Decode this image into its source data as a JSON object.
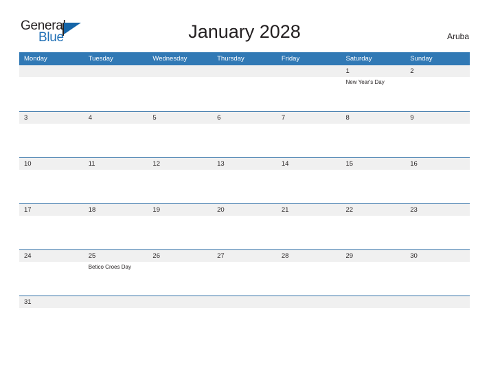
{
  "brand": {
    "word_one": "General",
    "word_two": "Blue",
    "flag_icon": "flag-triangle-icon",
    "blue": "#1565a8"
  },
  "header": {
    "title": "January 2028",
    "region": "Aruba"
  },
  "calendar": {
    "header_bg": "#3179b5",
    "band_bg": "#f0f0f0",
    "rule_color": "#2e6da4",
    "weekdays": [
      "Monday",
      "Tuesday",
      "Wednesday",
      "Thursday",
      "Friday",
      "Saturday",
      "Sunday"
    ],
    "weeks": [
      [
        {
          "day": "",
          "event": ""
        },
        {
          "day": "",
          "event": ""
        },
        {
          "day": "",
          "event": ""
        },
        {
          "day": "",
          "event": ""
        },
        {
          "day": "",
          "event": ""
        },
        {
          "day": "1",
          "event": "New Year's Day"
        },
        {
          "day": "2",
          "event": ""
        }
      ],
      [
        {
          "day": "3",
          "event": ""
        },
        {
          "day": "4",
          "event": ""
        },
        {
          "day": "5",
          "event": ""
        },
        {
          "day": "6",
          "event": ""
        },
        {
          "day": "7",
          "event": ""
        },
        {
          "day": "8",
          "event": ""
        },
        {
          "day": "9",
          "event": ""
        }
      ],
      [
        {
          "day": "10",
          "event": ""
        },
        {
          "day": "11",
          "event": ""
        },
        {
          "day": "12",
          "event": ""
        },
        {
          "day": "13",
          "event": ""
        },
        {
          "day": "14",
          "event": ""
        },
        {
          "day": "15",
          "event": ""
        },
        {
          "day": "16",
          "event": ""
        }
      ],
      [
        {
          "day": "17",
          "event": ""
        },
        {
          "day": "18",
          "event": ""
        },
        {
          "day": "19",
          "event": ""
        },
        {
          "day": "20",
          "event": ""
        },
        {
          "day": "21",
          "event": ""
        },
        {
          "day": "22",
          "event": ""
        },
        {
          "day": "23",
          "event": ""
        }
      ],
      [
        {
          "day": "24",
          "event": ""
        },
        {
          "day": "25",
          "event": "Betico Croes Day"
        },
        {
          "day": "26",
          "event": ""
        },
        {
          "day": "27",
          "event": ""
        },
        {
          "day": "28",
          "event": ""
        },
        {
          "day": "29",
          "event": ""
        },
        {
          "day": "30",
          "event": ""
        }
      ],
      [
        {
          "day": "31",
          "event": ""
        },
        {
          "day": "",
          "event": ""
        },
        {
          "day": "",
          "event": ""
        },
        {
          "day": "",
          "event": ""
        },
        {
          "day": "",
          "event": ""
        },
        {
          "day": "",
          "event": ""
        },
        {
          "day": "",
          "event": ""
        }
      ]
    ]
  }
}
